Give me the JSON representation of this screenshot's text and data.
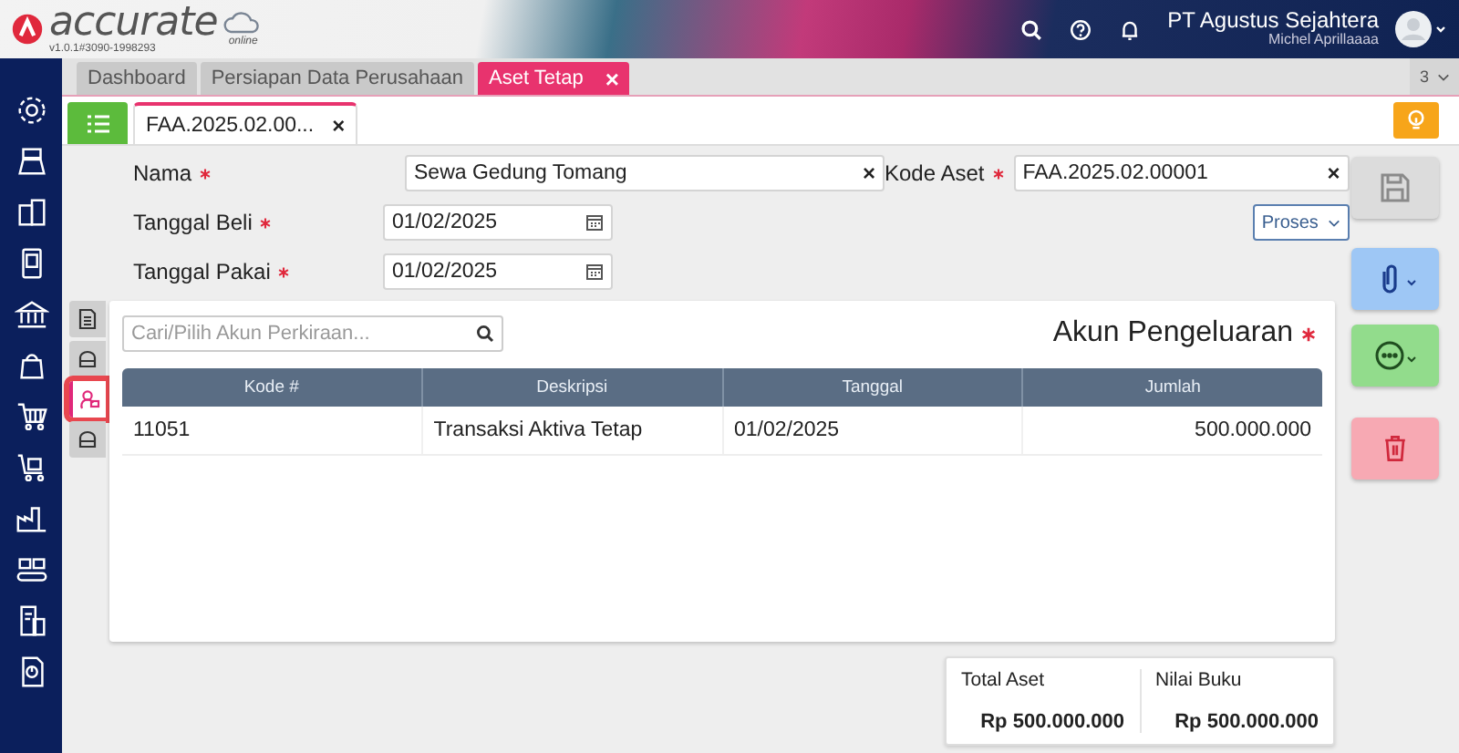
{
  "header": {
    "brand": "accurate",
    "brand_sub": "online",
    "version": "v1.0.1#3090-1998293",
    "company": "PT Agustus Sejahtera",
    "user": "Michel Aprillaaaa"
  },
  "tabs": [
    {
      "label": "Dashboard",
      "selected": false,
      "closable": false
    },
    {
      "label": "Persiapan Data Perusahaan",
      "selected": false,
      "closable": false
    },
    {
      "label": "Aset Tetap",
      "selected": true,
      "closable": true
    }
  ],
  "tab_count": "3",
  "subtab": {
    "label": "FAA.2025.02.00...",
    "close": "×"
  },
  "close_icon": "×",
  "form": {
    "fields": [
      {
        "label": "Nama",
        "required": true,
        "value": "Sewa Gedung Tomang",
        "kind": "text"
      },
      {
        "label": "Tanggal Beli",
        "required": true,
        "value": "01/02/2025",
        "kind": "date"
      },
      {
        "label": "Tanggal Pakai",
        "required": true,
        "value": "01/02/2025",
        "kind": "date"
      }
    ],
    "code_field": {
      "label": "Kode Aset",
      "required": true,
      "value": "FAA.2025.02.00001"
    },
    "process_button": "Proses"
  },
  "side_tabs": [
    {
      "selected": false
    },
    {
      "selected": false
    },
    {
      "selected": true
    },
    {
      "selected": false
    }
  ],
  "panel": {
    "search": {
      "placeholder": "Cari/Pilih Akun Perkiraan..."
    },
    "title": "Akun Pengeluaran",
    "required": true,
    "table": {
      "columns": [
        "Kode #",
        "Deskripsi",
        "Tanggal",
        "Jumlah"
      ],
      "rows": [
        [
          "11051",
          "Transaksi Aktiva Tetap",
          "01/02/2025",
          "500.000.000"
        ]
      ]
    }
  },
  "totals": [
    {
      "label": "Total Aset",
      "value": "Rp 500.000.000"
    },
    {
      "label": "Nilai Buku",
      "value": "Rp 500.000.000"
    }
  ]
}
